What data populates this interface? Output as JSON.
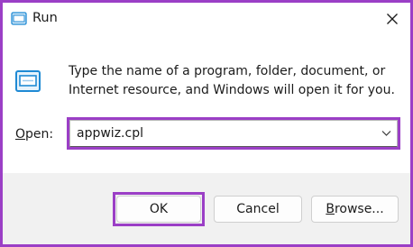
{
  "window": {
    "title": "Run"
  },
  "description": {
    "line1": "Type the name of a program, folder, document, or",
    "line2": "Internet resource, and Windows will open it for you."
  },
  "open_field": {
    "label_mnemonic": "O",
    "label_rest": "pen:",
    "value": "appwiz.cpl"
  },
  "buttons": {
    "ok": "OK",
    "cancel": "Cancel",
    "browse_mnemonic": "B",
    "browse_rest": "rowse..."
  },
  "colors": {
    "highlight": "#9b3fc6",
    "accent": "#1f8ad4"
  },
  "icons": {
    "app": "run-app-icon",
    "close": "close-icon",
    "run": "run-icon",
    "dropdown": "chevron-down-icon"
  }
}
